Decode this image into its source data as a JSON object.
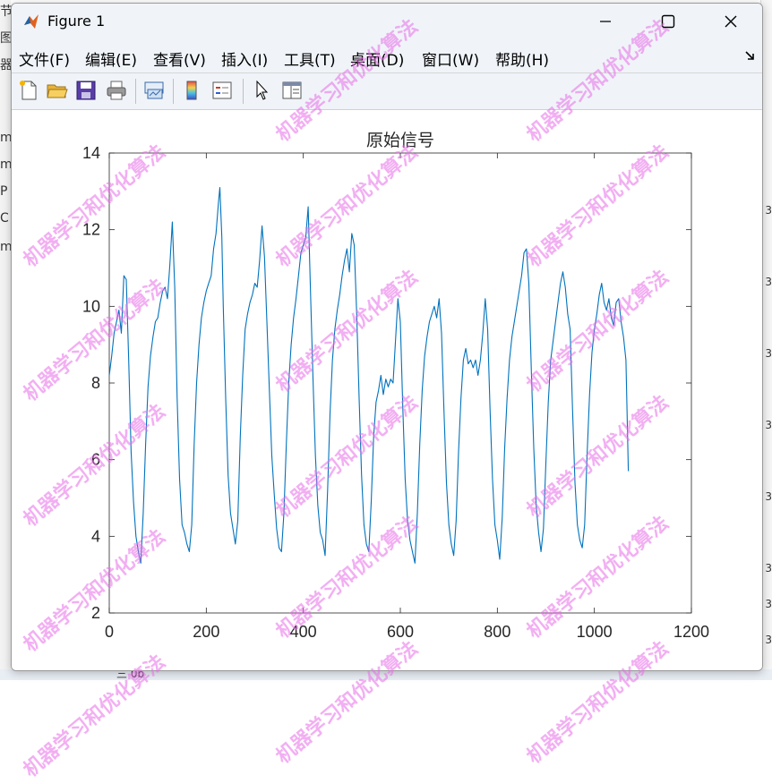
{
  "window": {
    "title": "Figure 1"
  },
  "menu": [
    "文件(F)",
    "编辑(E)",
    "查看(V)",
    "插入(I)",
    "工具(T)",
    "桌面(D)",
    "窗口(W)",
    "帮助(H)"
  ],
  "colors": {
    "line": "#0072bd",
    "titlebar": "#f0f4f9",
    "watermark": "#e86ee8"
  },
  "watermark_text": "机器学习和优化算法",
  "background_fragments": {
    "left": [
      "节",
      "图",
      "器",
      "m",
      "m",
      "P",
      "C",
      "m"
    ],
    "right": [
      "3",
      "3",
      "3",
      "3",
      "3",
      "3",
      "3",
      "3"
    ],
    "bottom": "三  0b"
  },
  "chart_data": {
    "type": "line",
    "title": "原始信号",
    "xlabel": "",
    "ylabel": "",
    "xlim": [
      0,
      1200
    ],
    "ylim": [
      2,
      14
    ],
    "xticks": [
      0,
      200,
      400,
      600,
      800,
      1000,
      1200
    ],
    "yticks": [
      2,
      4,
      6,
      8,
      10,
      12,
      14
    ],
    "grid": false,
    "series": [
      {
        "points": [
          [
            0,
            8.2
          ],
          [
            5,
            8.7
          ],
          [
            10,
            9.3
          ],
          [
            15,
            9.6
          ],
          [
            20,
            9.9
          ],
          [
            25,
            9.3
          ],
          [
            30,
            10.8
          ],
          [
            35,
            10.7
          ],
          [
            40,
            8.6
          ],
          [
            45,
            6.2
          ],
          [
            50,
            4.9
          ],
          [
            55,
            4.0
          ],
          [
            60,
            3.6
          ],
          [
            65,
            3.3
          ],
          [
            70,
            4.6
          ],
          [
            75,
            6.4
          ],
          [
            80,
            7.9
          ],
          [
            85,
            8.7
          ],
          [
            90,
            9.2
          ],
          [
            95,
            9.6
          ],
          [
            100,
            9.7
          ],
          [
            105,
            10.1
          ],
          [
            110,
            10.4
          ],
          [
            115,
            10.5
          ],
          [
            120,
            10.2
          ],
          [
            125,
            11.1
          ],
          [
            130,
            12.2
          ],
          [
            135,
            10.5
          ],
          [
            140,
            7.6
          ],
          [
            145,
            5.5
          ],
          [
            150,
            4.3
          ],
          [
            155,
            4.1
          ],
          [
            160,
            3.8
          ],
          [
            165,
            3.6
          ],
          [
            170,
            4.3
          ],
          [
            175,
            6.4
          ],
          [
            180,
            8.0
          ],
          [
            185,
            9.0
          ],
          [
            190,
            9.7
          ],
          [
            195,
            10.1
          ],
          [
            200,
            10.4
          ],
          [
            205,
            10.6
          ],
          [
            210,
            10.8
          ],
          [
            215,
            11.5
          ],
          [
            220,
            11.9
          ],
          [
            225,
            12.7
          ],
          [
            228,
            13.1
          ],
          [
            232,
            11.8
          ],
          [
            235,
            10.0
          ],
          [
            240,
            7.6
          ],
          [
            245,
            5.6
          ],
          [
            250,
            4.6
          ],
          [
            255,
            4.2
          ],
          [
            260,
            3.8
          ],
          [
            265,
            4.4
          ],
          [
            270,
            6.6
          ],
          [
            275,
            8.2
          ],
          [
            280,
            9.4
          ],
          [
            285,
            9.8
          ],
          [
            290,
            10.1
          ],
          [
            295,
            10.3
          ],
          [
            300,
            10.6
          ],
          [
            305,
            10.5
          ],
          [
            310,
            11.2
          ],
          [
            315,
            12.1
          ],
          [
            320,
            11.3
          ],
          [
            325,
            9.6
          ],
          [
            330,
            7.8
          ],
          [
            335,
            6.1
          ],
          [
            340,
            5.1
          ],
          [
            345,
            4.2
          ],
          [
            350,
            3.7
          ],
          [
            355,
            3.6
          ],
          [
            360,
            4.6
          ],
          [
            365,
            6.4
          ],
          [
            370,
            8.0
          ],
          [
            375,
            9.0
          ],
          [
            380,
            9.7
          ],
          [
            385,
            10.2
          ],
          [
            390,
            10.8
          ],
          [
            395,
            11.4
          ],
          [
            400,
            11.6
          ],
          [
            405,
            11.8
          ],
          [
            410,
            12.6
          ],
          [
            415,
            10.3
          ],
          [
            420,
            8.1
          ],
          [
            425,
            6.1
          ],
          [
            430,
            4.8
          ],
          [
            435,
            4.1
          ],
          [
            440,
            3.9
          ],
          [
            445,
            3.5
          ],
          [
            450,
            5.2
          ],
          [
            455,
            7.2
          ],
          [
            460,
            8.6
          ],
          [
            465,
            9.4
          ],
          [
            470,
            9.9
          ],
          [
            475,
            10.3
          ],
          [
            480,
            10.8
          ],
          [
            485,
            11.2
          ],
          [
            490,
            11.5
          ],
          [
            495,
            10.9
          ],
          [
            500,
            11.9
          ],
          [
            505,
            11.6
          ],
          [
            510,
            9.8
          ],
          [
            515,
            7.6
          ],
          [
            520,
            5.6
          ],
          [
            525,
            4.3
          ],
          [
            530,
            3.8
          ],
          [
            535,
            3.6
          ],
          [
            540,
            4.9
          ],
          [
            545,
            6.6
          ],
          [
            550,
            7.5
          ],
          [
            555,
            7.8
          ],
          [
            560,
            8.2
          ],
          [
            565,
            7.7
          ],
          [
            570,
            8.1
          ],
          [
            575,
            7.9
          ],
          [
            580,
            8.1
          ],
          [
            585,
            8.0
          ],
          [
            590,
            9.1
          ],
          [
            595,
            10.2
          ],
          [
            600,
            9.6
          ],
          [
            605,
            7.4
          ],
          [
            610,
            5.5
          ],
          [
            615,
            4.4
          ],
          [
            620,
            3.9
          ],
          [
            625,
            3.6
          ],
          [
            630,
            3.3
          ],
          [
            635,
            4.6
          ],
          [
            640,
            6.4
          ],
          [
            645,
            7.8
          ],
          [
            650,
            8.7
          ],
          [
            655,
            9.2
          ],
          [
            660,
            9.6
          ],
          [
            665,
            9.8
          ],
          [
            670,
            10.0
          ],
          [
            675,
            9.7
          ],
          [
            680,
            10.2
          ],
          [
            685,
            9.3
          ],
          [
            690,
            7.3
          ],
          [
            695,
            5.4
          ],
          [
            700,
            4.3
          ],
          [
            705,
            3.8
          ],
          [
            710,
            3.5
          ],
          [
            715,
            4.4
          ],
          [
            720,
            6.2
          ],
          [
            725,
            7.6
          ],
          [
            730,
            8.6
          ],
          [
            735,
            8.9
          ],
          [
            740,
            8.5
          ],
          [
            745,
            8.6
          ],
          [
            750,
            8.4
          ],
          [
            755,
            8.6
          ],
          [
            760,
            8.2
          ],
          [
            765,
            8.6
          ],
          [
            770,
            9.3
          ],
          [
            775,
            10.2
          ],
          [
            780,
            9.4
          ],
          [
            785,
            7.3
          ],
          [
            790,
            5.5
          ],
          [
            795,
            4.3
          ],
          [
            800,
            3.9
          ],
          [
            805,
            3.4
          ],
          [
            810,
            4.5
          ],
          [
            815,
            6.3
          ],
          [
            820,
            7.6
          ],
          [
            825,
            8.6
          ],
          [
            830,
            9.2
          ],
          [
            835,
            9.6
          ],
          [
            840,
            10.0
          ],
          [
            845,
            10.4
          ],
          [
            850,
            10.8
          ],
          [
            855,
            11.4
          ],
          [
            860,
            11.5
          ],
          [
            865,
            10.6
          ],
          [
            870,
            8.3
          ],
          [
            875,
            6.3
          ],
          [
            880,
            4.8
          ],
          [
            885,
            4.1
          ],
          [
            890,
            3.6
          ],
          [
            895,
            4.2
          ],
          [
            900,
            5.9
          ],
          [
            905,
            7.5
          ],
          [
            910,
            8.6
          ],
          [
            915,
            9.1
          ],
          [
            920,
            9.6
          ],
          [
            925,
            10.1
          ],
          [
            930,
            10.6
          ],
          [
            935,
            10.9
          ],
          [
            940,
            10.5
          ],
          [
            945,
            9.8
          ],
          [
            950,
            9.4
          ],
          [
            955,
            7.3
          ],
          [
            960,
            5.4
          ],
          [
            965,
            4.3
          ],
          [
            970,
            3.9
          ],
          [
            975,
            3.7
          ],
          [
            980,
            4.3
          ],
          [
            985,
            6.1
          ],
          [
            990,
            7.7
          ],
          [
            995,
            8.8
          ],
          [
            1000,
            9.4
          ],
          [
            1005,
            9.8
          ],
          [
            1010,
            10.3
          ],
          [
            1015,
            10.6
          ],
          [
            1020,
            10.1
          ],
          [
            1025,
            9.9
          ],
          [
            1030,
            10.2
          ],
          [
            1035,
            9.7
          ],
          [
            1040,
            9.5
          ],
          [
            1045,
            10.1
          ],
          [
            1050,
            10.2
          ],
          [
            1055,
            9.6
          ],
          [
            1060,
            9.2
          ],
          [
            1065,
            8.6
          ],
          [
            1070,
            5.7
          ]
        ]
      }
    ]
  }
}
